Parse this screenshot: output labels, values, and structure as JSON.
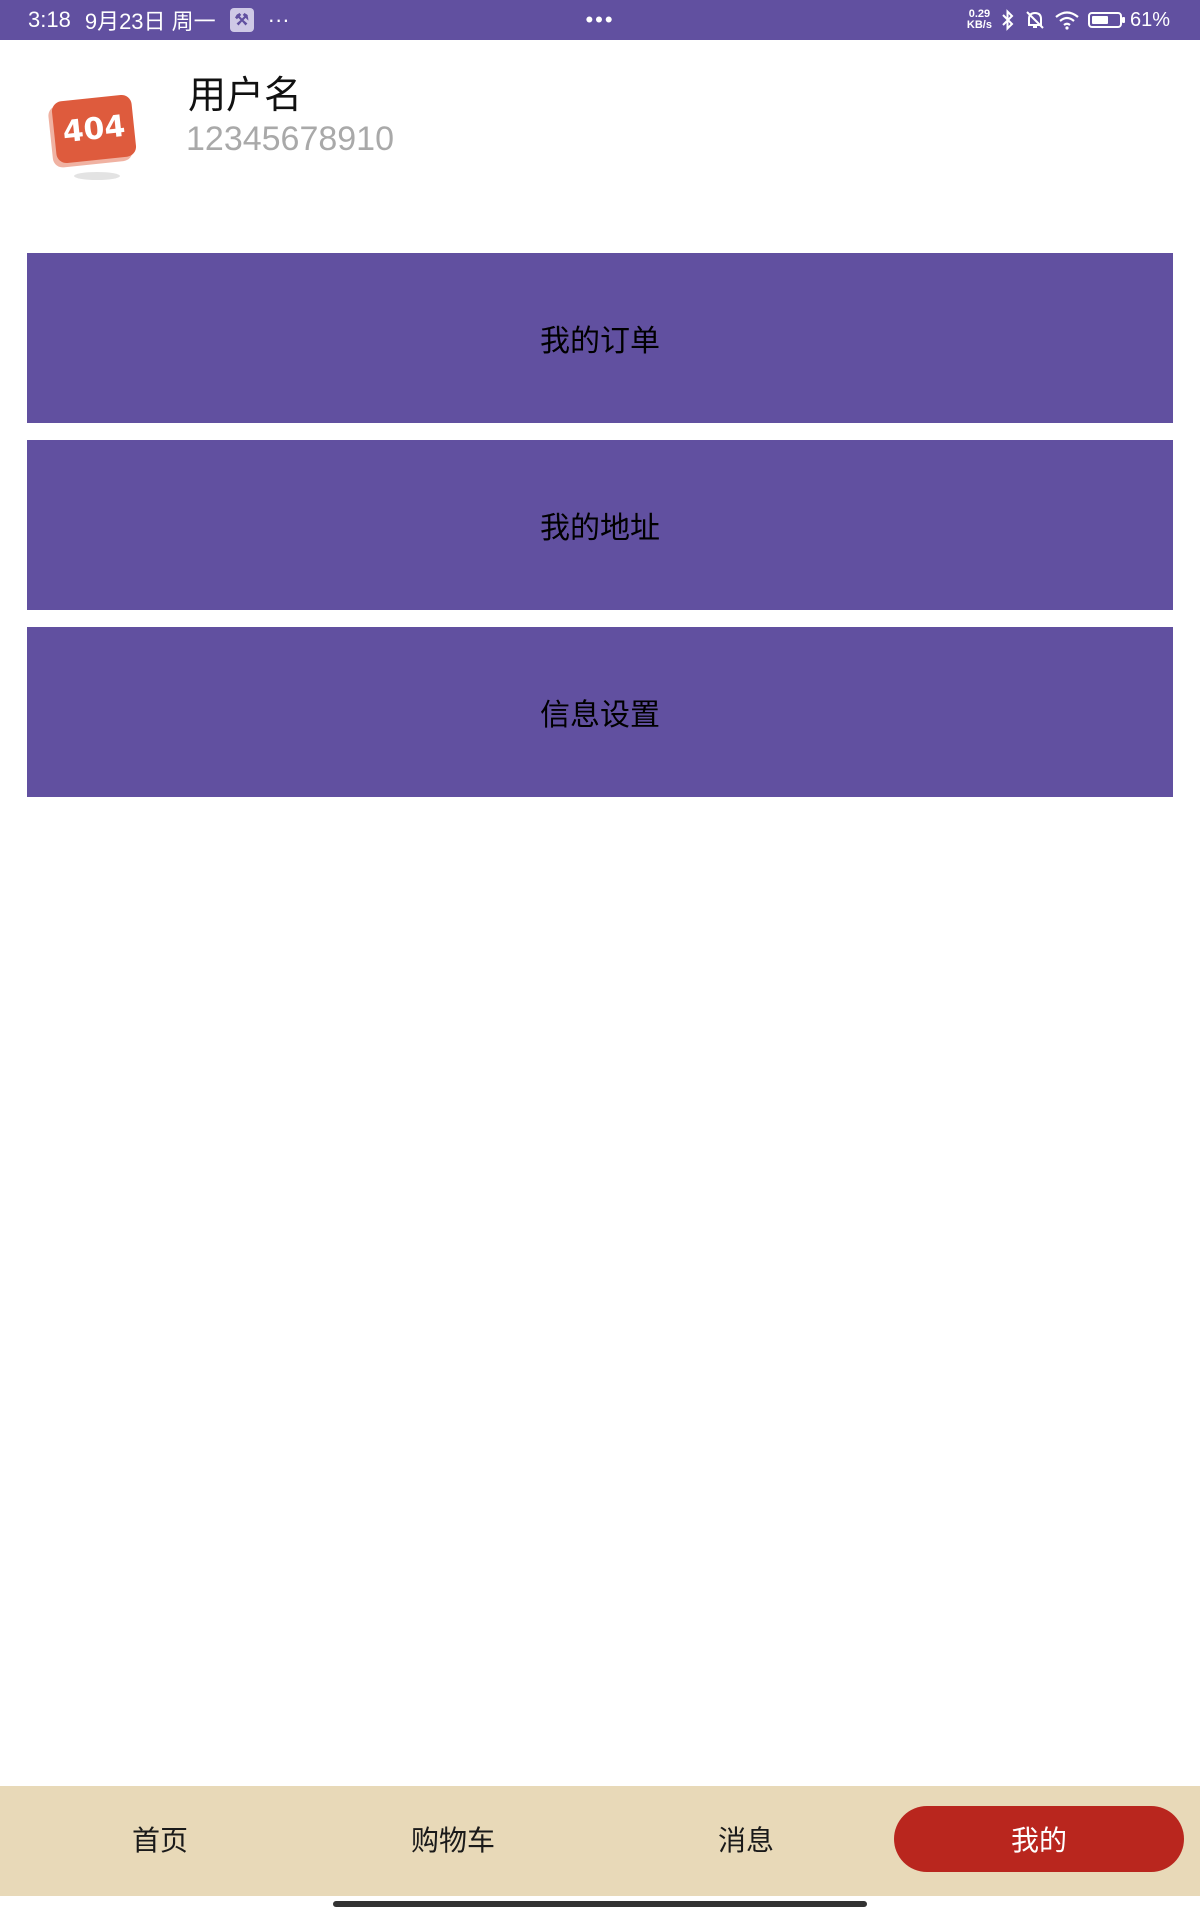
{
  "status_bar": {
    "time": "3:18",
    "date": "9月23日 周一",
    "more": "···",
    "center_dots": "•••",
    "net_speed_value": "0.29",
    "net_speed_unit": "KB/s",
    "battery_percent": "61%",
    "battery_level": 0.61,
    "icons": [
      "wrench-icon",
      "bluetooth-icon",
      "bell-off-icon",
      "wifi-icon",
      "battery-icon"
    ]
  },
  "profile": {
    "avatar_text": "404",
    "username": "用户名",
    "phone": "12345678910"
  },
  "menu": {
    "items": [
      {
        "label": "我的订单"
      },
      {
        "label": "我的地址"
      },
      {
        "label": "信息设置"
      }
    ]
  },
  "bottom_nav": {
    "items": [
      {
        "label": "首页"
      },
      {
        "label": "购物车"
      },
      {
        "label": "消息"
      },
      {
        "label": "我的"
      }
    ],
    "active_index": 3
  },
  "colors": {
    "primary": "#6150a0",
    "nav_background": "#e8d9b8",
    "active_tab": "#b9261e"
  }
}
